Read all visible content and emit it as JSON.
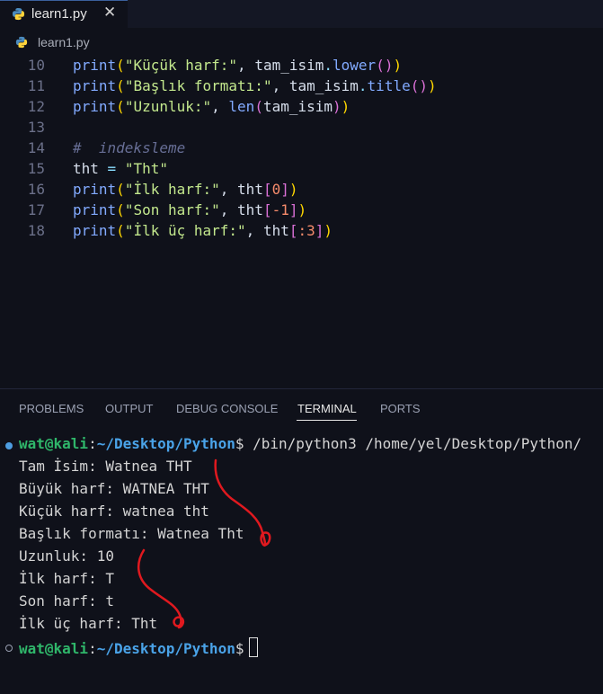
{
  "tab": {
    "filename": "learn1.py",
    "close_glyph": "✕"
  },
  "breadcrumb": {
    "filename": "learn1.py"
  },
  "editor": {
    "lines": [
      {
        "n": "10",
        "tokens": [
          [
            "print",
            "fn"
          ],
          [
            "(",
            "br1"
          ],
          [
            "\"Küçük harf:\"",
            "str"
          ],
          [
            ", ",
            "var"
          ],
          [
            "tam_isim",
            "var"
          ],
          [
            ".",
            "op"
          ],
          [
            "lower",
            "fn"
          ],
          [
            "()",
            "br2"
          ],
          [
            ")",
            "br1"
          ]
        ]
      },
      {
        "n": "11",
        "tokens": [
          [
            "print",
            "fn"
          ],
          [
            "(",
            "br1"
          ],
          [
            "\"Başlık formatı:\"",
            "str"
          ],
          [
            ", ",
            "var"
          ],
          [
            "tam_isim",
            "var"
          ],
          [
            ".",
            "op"
          ],
          [
            "title",
            "fn"
          ],
          [
            "()",
            "br2"
          ],
          [
            ")",
            "br1"
          ]
        ]
      },
      {
        "n": "12",
        "tokens": [
          [
            "print",
            "fn"
          ],
          [
            "(",
            "br1"
          ],
          [
            "\"Uzunluk:\"",
            "str"
          ],
          [
            ", ",
            "var"
          ],
          [
            "len",
            "fn"
          ],
          [
            "(",
            "br2"
          ],
          [
            "tam_isim",
            "var"
          ],
          [
            ")",
            "br2"
          ],
          [
            ")",
            "br1"
          ]
        ]
      },
      {
        "n": "13",
        "tokens": []
      },
      {
        "n": "14",
        "tokens": [
          [
            "#  indeksleme",
            "cm"
          ]
        ]
      },
      {
        "n": "15",
        "tokens": [
          [
            "tht",
            "var"
          ],
          [
            " = ",
            "op"
          ],
          [
            "\"Tht\"",
            "str"
          ]
        ]
      },
      {
        "n": "16",
        "tokens": [
          [
            "print",
            "fn"
          ],
          [
            "(",
            "br1"
          ],
          [
            "\"İlk harf:\"",
            "str"
          ],
          [
            ", ",
            "var"
          ],
          [
            "tht",
            "var"
          ],
          [
            "[",
            "br2"
          ],
          [
            "0",
            "num"
          ],
          [
            "]",
            "br2"
          ],
          [
            ")",
            "br1"
          ]
        ]
      },
      {
        "n": "17",
        "tokens": [
          [
            "print",
            "fn"
          ],
          [
            "(",
            "br1"
          ],
          [
            "\"Son harf:\"",
            "str"
          ],
          [
            ", ",
            "var"
          ],
          [
            "tht",
            "var"
          ],
          [
            "[",
            "br2"
          ],
          [
            "-1",
            "num"
          ],
          [
            "]",
            "br2"
          ],
          [
            ")",
            "br1"
          ]
        ]
      },
      {
        "n": "18",
        "tokens": [
          [
            "print",
            "fn"
          ],
          [
            "(",
            "br1"
          ],
          [
            "\"İlk üç harf:\"",
            "str"
          ],
          [
            ", ",
            "var"
          ],
          [
            "tht",
            "var"
          ],
          [
            "[",
            "br2"
          ],
          [
            ":3",
            "num"
          ],
          [
            "]",
            "br2"
          ],
          [
            ")",
            "br1"
          ]
        ]
      }
    ]
  },
  "panel": {
    "tabs": [
      "PROBLEMS",
      "OUTPUT",
      "DEBUG CONSOLE",
      "TERMINAL",
      "PORTS"
    ],
    "active": "TERMINAL"
  },
  "terminal": {
    "prompt_user": "wat@kali",
    "prompt_sep": ":",
    "prompt_path": "~/Desktop/Python",
    "prompt_symbol": "$",
    "command": " /bin/python3 /home/yel/Desktop/Python/",
    "output": [
      "Tam İsim: Watnea THT",
      "Büyük harf: WATNEA THT",
      "Küçük harf: watnea tht",
      "Başlık formatı: Watnea Tht",
      "Uzunluk: 10",
      "İlk harf: T",
      "Son harf: t",
      "İlk üç harf: Tht"
    ]
  },
  "colors": {
    "background": "#0f111a",
    "annotation": "#e0191f",
    "prompt_user": "#2fb66a",
    "prompt_path": "#4aa3e8"
  }
}
